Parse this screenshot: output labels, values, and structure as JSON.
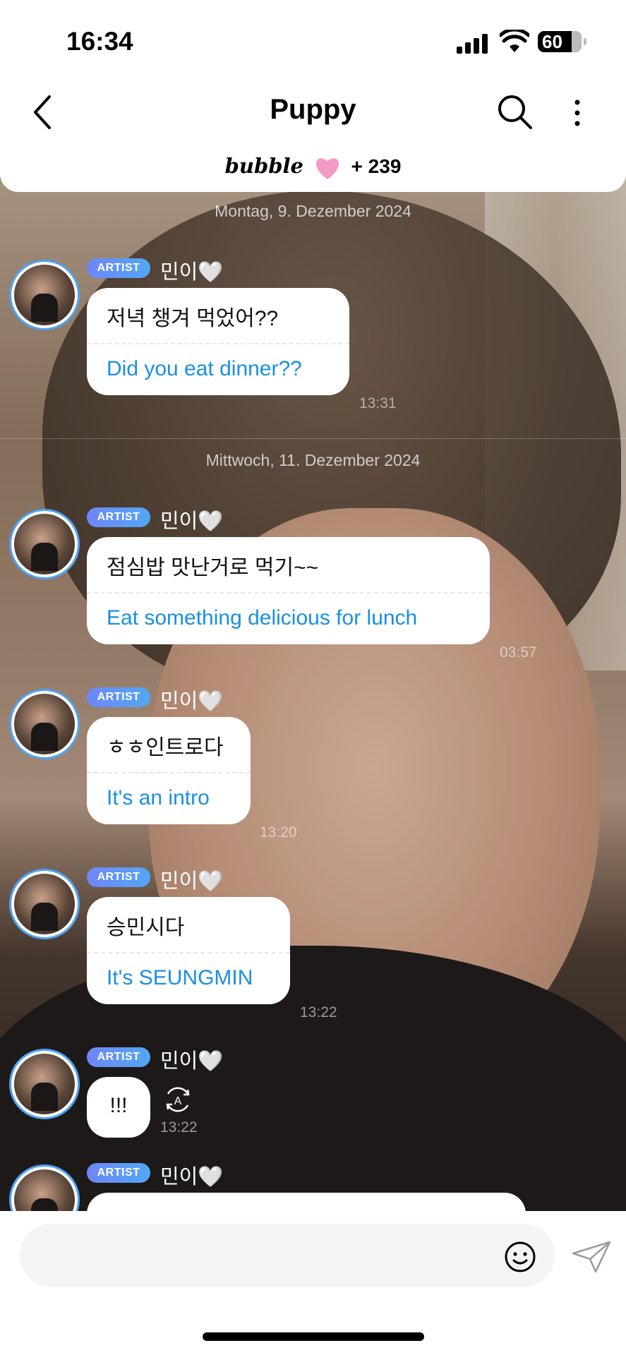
{
  "status_bar": {
    "time": "16:34",
    "battery": "60"
  },
  "header": {
    "title": "Puppy",
    "bubble_brand": "bubble",
    "bubble_count": "+ 239"
  },
  "dates": [
    "Montag, 9. Dezember 2024",
    "Mittwoch, 11. Dezember 2024"
  ],
  "messages": [
    {
      "badge": "ARTIST",
      "name": "민이🤍",
      "ko": "저녁 챙겨 먹었어??",
      "en": "Did you eat dinner??",
      "time": "13:31"
    },
    {
      "badge": "ARTIST",
      "name": "민이🤍",
      "ko": "점심밥 맛난거로 먹기~~",
      "en": "Eat something delicious for lunch",
      "time": "03:57"
    },
    {
      "badge": "ARTIST",
      "name": "민이🤍",
      "ko": "ㅎㅎ인트로다",
      "en": "It's an intro",
      "time": "13:20"
    },
    {
      "badge": "ARTIST",
      "name": "민이🤍",
      "ko": "승민시다",
      "en": "It's SEUNGMIN",
      "time": "13:22"
    },
    {
      "badge": "ARTIST",
      "name": "민이🤍",
      "ko": "!!!",
      "time": "13:22",
      "translate_icon": "translate-icon"
    },
    {
      "badge": "ARTIST",
      "name": "민이🤍"
    }
  ],
  "composer": {
    "placeholder": ""
  },
  "icons": [
    "back-icon",
    "search-icon",
    "more-icon",
    "heart-icon",
    "translate-icon",
    "emoji-icon",
    "send-icon"
  ]
}
